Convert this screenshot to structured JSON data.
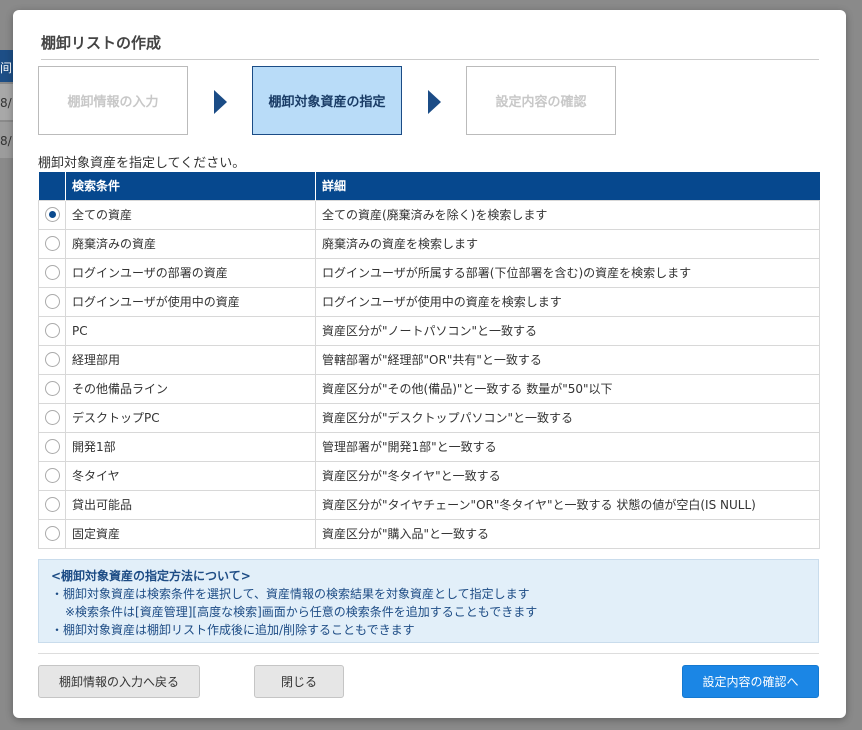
{
  "background": {
    "strip1": "间",
    "strip2": "8/",
    "strip3": "8/"
  },
  "modal": {
    "title": "棚卸リストの作成",
    "steps": [
      {
        "label": "棚卸情報の入力",
        "state": "inactive"
      },
      {
        "label": "棚卸対象資産の指定",
        "state": "active"
      },
      {
        "label": "設定内容の確認",
        "state": "inactive"
      }
    ],
    "instruction": "棚卸対象資産を指定してください。",
    "table": {
      "headers": [
        "",
        "検索条件",
        "詳細"
      ],
      "selected_index": 0,
      "rows": [
        {
          "condition": "全ての資産",
          "detail": "全ての資産(廃棄済みを除く)を検索します"
        },
        {
          "condition": "廃棄済みの資産",
          "detail": "廃棄済みの資産を検索します"
        },
        {
          "condition": "ログインユーザの部署の資産",
          "detail": "ログインユーザが所属する部署(下位部署を含む)の資産を検索します"
        },
        {
          "condition": "ログインユーザが使用中の資産",
          "detail": "ログインユーザが使用中の資産を検索します"
        },
        {
          "condition": "PC",
          "detail": "資産区分が\"ノートパソコン\"と一致する"
        },
        {
          "condition": "経理部用",
          "detail": "管轄部署が\"経理部\"OR\"共有\"と一致する"
        },
        {
          "condition": "その他備品ライン",
          "detail": "資産区分が\"その他(備品)\"と一致する 数量が\"50\"以下"
        },
        {
          "condition": "デスクトップPC",
          "detail": "資産区分が\"デスクトップパソコン\"と一致する"
        },
        {
          "condition": "開発1部",
          "detail": "管理部署が\"開発1部\"と一致する"
        },
        {
          "condition": "冬タイヤ",
          "detail": "資産区分が\"冬タイヤ\"と一致する"
        },
        {
          "condition": "貸出可能品",
          "detail": "資産区分が\"タイヤチェーン\"OR\"冬タイヤ\"と一致する 状態の値が空白(IS NULL)"
        },
        {
          "condition": "固定資産",
          "detail": "資産区分が\"購入品\"と一致する"
        }
      ]
    },
    "info": {
      "title": "<棚卸対象資産の指定方法について>",
      "line1": "・棚卸対象資産は検索条件を選択して、資産情報の検索結果を対象資産として指定します",
      "line2": "※検索条件は[資産管理][高度な検索]画面から任意の検索条件を追加することもできます",
      "line3": "・棚卸対象資産は棚卸リスト作成後に追加/削除することもできます"
    },
    "buttons": {
      "back": "棚卸情報の入力へ戻る",
      "close": "閉じる",
      "next": "設定内容の確認へ"
    }
  },
  "colors": {
    "header_bg": "#06488e",
    "active_step_bg": "#b9dcf8",
    "primary_button": "#1b86e5",
    "info_bg": "#e2eff9"
  }
}
